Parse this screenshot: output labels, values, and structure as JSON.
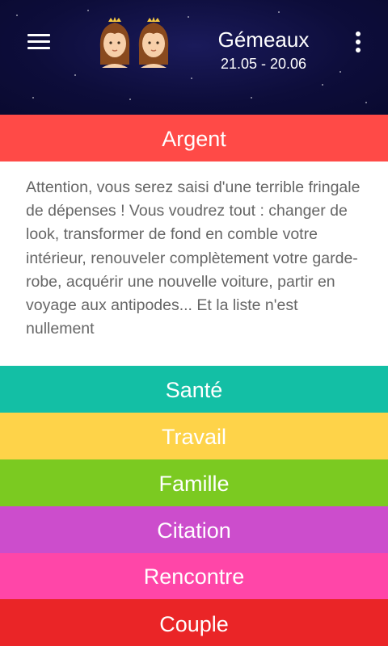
{
  "header": {
    "sign_name": "Gémeaux",
    "sign_dates": "21.05 - 20.06",
    "icons": {
      "menu": "hamburger-menu-icon",
      "sign": "gemini-twins-icon",
      "more": "overflow-menu-icon"
    },
    "background_color": "#0d0d3a"
  },
  "categories": [
    {
      "label": "Argent",
      "color": "#ff4a47",
      "expanded": true
    },
    {
      "label": "Santé",
      "color": "#13bfa5"
    },
    {
      "label": "Travail",
      "color": "#fed349"
    },
    {
      "label": "Famille",
      "color": "#7bca21"
    },
    {
      "label": "Citation",
      "color": "#cc4dcc"
    },
    {
      "label": "Rencontre",
      "color": "#ff46a8"
    },
    {
      "label": "Couple",
      "color": "#ea2527"
    }
  ],
  "content": {
    "text": "Attention, vous serez saisi d'une terrible fringale de dépenses ! Vous voudrez tout : changer de look, transformer de fond en comble votre intérieur, renouveler complètement votre garde-robe, acquérir une nouvelle voiture, partir en voyage aux antipodes... Et la liste n'est nullement"
  }
}
